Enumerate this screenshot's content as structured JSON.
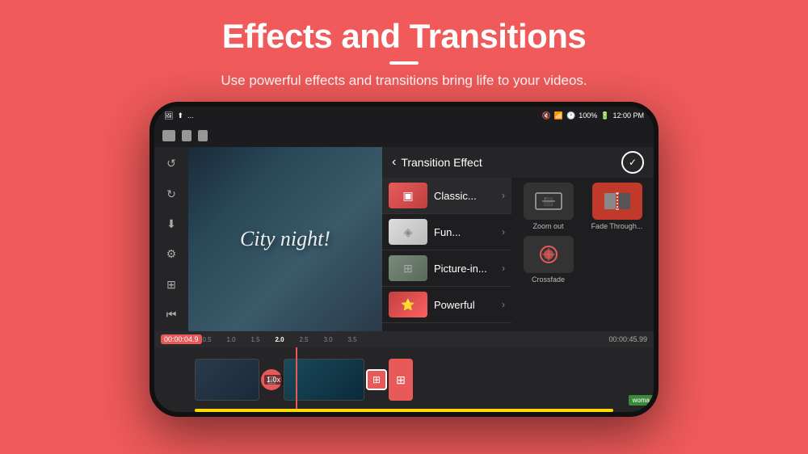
{
  "header": {
    "title": "Effects and Transitions",
    "divider": "—",
    "subtitle": "Use powerful effects and transitions bring life to your videos."
  },
  "statusBar": {
    "leftIcons": [
      "img-icon",
      "upload-icon",
      "more-icon"
    ],
    "rightItems": [
      "mute-icon",
      "wifi-icon",
      "clock-icon",
      "battery-label",
      "time-label"
    ],
    "batteryLabel": "100%",
    "timeLabel": "12:00 PM"
  },
  "sidebar": {
    "icons": [
      "undo-icon",
      "redo-icon",
      "share-icon",
      "settings-icon",
      "layers-icon",
      "skip-back-icon"
    ]
  },
  "videoPreview": {
    "cityText": "City night!"
  },
  "panel": {
    "title": "Transition Effect",
    "backLabel": "‹",
    "checkLabel": "✓",
    "categories": [
      {
        "name": "Classic...",
        "thumbType": "classic"
      },
      {
        "name": "Fun...",
        "thumbType": "fun"
      },
      {
        "name": "Picture-in...",
        "thumbType": "picture"
      },
      {
        "name": "Powerful",
        "thumbType": "powerful"
      }
    ],
    "effects": [
      {
        "label": "Zoom out",
        "icon": "⬛",
        "selected": false
      },
      {
        "label": "Fade Through...",
        "icon": "⬛",
        "selected": true
      },
      {
        "label": "Crossfade",
        "icon": "⬛",
        "selected": false
      }
    ]
  },
  "timeline": {
    "timestampLeft": "00:00:04.9",
    "timestampRight": "00:00:45.99",
    "rulers": [
      "0.5",
      "1.0",
      "1.5",
      "2.0",
      "2.5",
      "3.0",
      "3.5"
    ],
    "clipLabel": "1.0x",
    "watermark": "woma"
  }
}
